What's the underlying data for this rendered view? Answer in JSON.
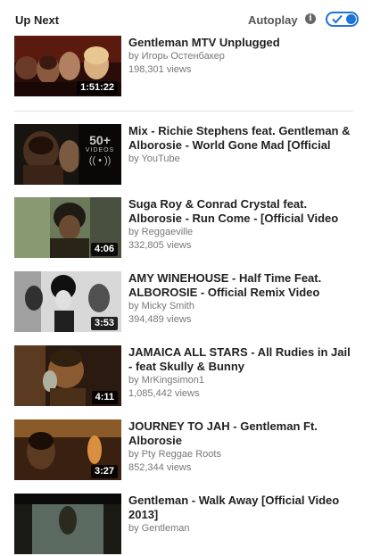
{
  "header": {
    "up_next": "Up Next",
    "autoplay_label": "Autoplay",
    "info_symbol": "i",
    "autoplay_on": true,
    "accent_color": "#1e73d6"
  },
  "up_next_video": {
    "title": "Gentleman MTV Unplugged",
    "channel": "by Игорь Остенбакер",
    "views": "198,301 views",
    "duration": "1:51:22"
  },
  "videos": [
    {
      "title_line1": "Mix - Richie Stephens feat. Gentleman &",
      "title_line2": "Alborosie - World Gone Mad [Official",
      "channel": "by YouTube",
      "views": "",
      "mix_count": "50+",
      "mix_label": "VIDEOS",
      "mix_icon": "(( • ))"
    },
    {
      "title_line1": "Suga Roy & Conrad Crystal feat.",
      "title_line2": "Alborosie - Run Come - [Official Video",
      "channel": "by Reggaeville",
      "views": "332,805 views",
      "duration": "4:06"
    },
    {
      "title_line1": "AMY WINEHOUSE - Half Time Feat.",
      "title_line2": "ALBOROSIE - Official Remix Video",
      "channel": "by Micky Smith",
      "views": "394,489 views",
      "duration": "3:53"
    },
    {
      "title_line1": "JAMAICA ALL STARS - All Rudies in Jail",
      "title_line2": "- feat Skully & Bunny",
      "channel": "by MrKingsimon1",
      "views": "1,085,442 views",
      "duration": "4:11"
    },
    {
      "title_line1": "JOURNEY TO JAH - Gentleman Ft.",
      "title_line2": "Alborosie",
      "channel": "by Pty Reggae Roots",
      "views": "852,344 views",
      "duration": "3:27"
    },
    {
      "title_line1": "Gentleman - Walk Away [Official Video",
      "title_line2": "2013]",
      "channel": "by Gentleman",
      "views": "",
      "duration": ""
    }
  ]
}
